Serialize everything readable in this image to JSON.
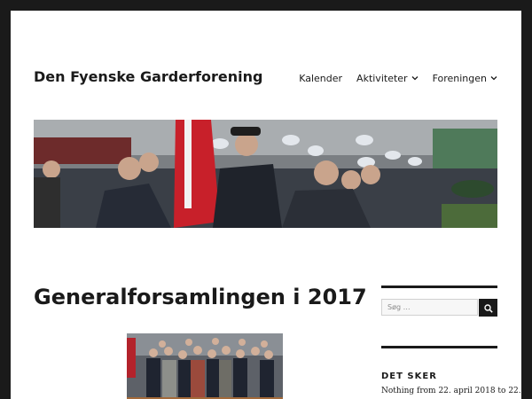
{
  "header": {
    "site_title": "Den Fyenske Garderforening",
    "nav": [
      {
        "label": "Kalender",
        "has_submenu": false
      },
      {
        "label": "Aktiviteter",
        "has_submenu": true
      },
      {
        "label": "Foreningen",
        "has_submenu": true
      }
    ],
    "chevron_icon": "chevron-down-icon"
  },
  "post": {
    "title": "Generalforsamlingen i 2017"
  },
  "sidebar": {
    "search_placeholder": "Søg …",
    "search_icon": "search-icon",
    "widget_title": "DET SKER",
    "widget_text": "Nothing from 22. april 2018 to 22."
  },
  "colors": {
    "frame": "#1a1a1a",
    "page_bg": "#ffffff",
    "text": "#1a1a1a",
    "search_bg": "#f7f7f7",
    "search_border": "#d1d1d1"
  }
}
